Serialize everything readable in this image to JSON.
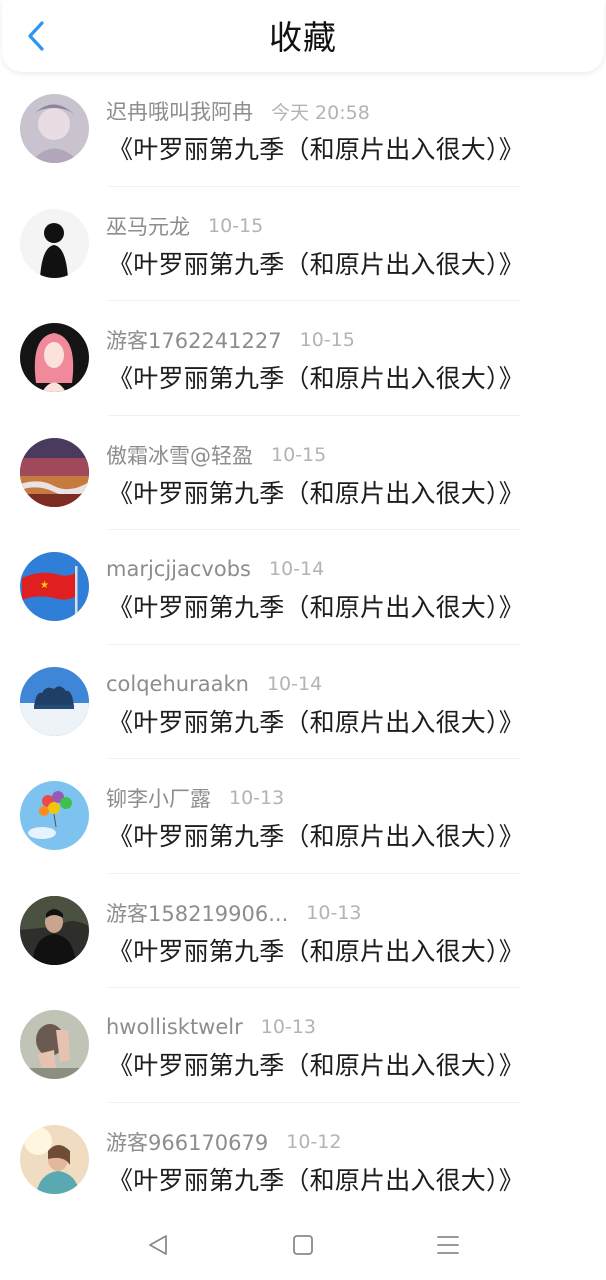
{
  "header": {
    "title": "收藏",
    "back_icon": "chevron-left-icon"
  },
  "colors": {
    "accent": "#2f93f1",
    "text": "#1d1d1d",
    "meta": "#8d8d8d"
  },
  "favorites": [
    {
      "user": "迟冉哦叫我阿冉",
      "time": "今天 20:58",
      "content": "《叶罗丽第九季（和原片出入很大）》",
      "avatar": "anime-portrait-avatar"
    },
    {
      "user": "巫马元龙",
      "time": "10-15",
      "content": "《叶罗丽第九季（和原片出入很大）》",
      "avatar": "silhouette-avatar"
    },
    {
      "user": "游客1762241227",
      "time": "10-15",
      "content": "《叶罗丽第九季（和原片出入很大）》",
      "avatar": "pink-hair-girl-avatar"
    },
    {
      "user": "傲霜冰雪@轻盈",
      "time": "10-15",
      "content": "《叶罗丽第九季（和原片出入很大）》",
      "avatar": "landscape-avatar"
    },
    {
      "user": "marjcjjacvobs",
      "time": "10-14",
      "content": "《叶罗丽第九季（和原片出入很大）》",
      "avatar": "flag-avatar"
    },
    {
      "user": "colqehuraakn",
      "time": "10-14",
      "content": "《叶罗丽第九季（和原片出入很大）》",
      "avatar": "snowy-trees-avatar"
    },
    {
      "user": "铆李小厂露",
      "time": "10-13",
      "content": "《叶罗丽第九季（和原片出入很大）》",
      "avatar": "balloons-avatar"
    },
    {
      "user": "游客158219906...",
      "time": "10-13",
      "content": "《叶罗丽第九季（和原片出入很大）》",
      "avatar": "man-portrait-avatar"
    },
    {
      "user": "hwollisktwelr",
      "time": "10-13",
      "content": "《叶罗丽第九季（和原片出入很大）》",
      "avatar": "hands-photo-avatar"
    },
    {
      "user": "游客966170679",
      "time": "10-12",
      "content": "《叶罗丽第九季（和原片出入很大）》",
      "avatar": "sunlight-portrait-avatar"
    }
  ],
  "nav": {
    "back": "nav-back-icon",
    "home": "nav-home-icon",
    "menu": "nav-menu-icon"
  }
}
